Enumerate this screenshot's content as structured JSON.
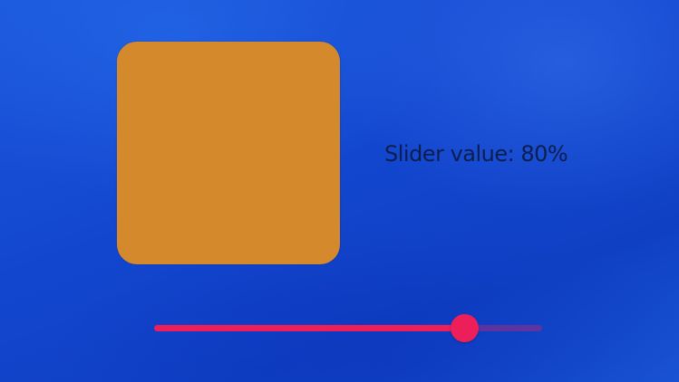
{
  "swatch": {
    "color": "#d4892c"
  },
  "slider": {
    "label": "Slider value: 80%",
    "value": 0.8,
    "accent_color": "#ec1f5a",
    "track_color": "#ec1f5a"
  }
}
